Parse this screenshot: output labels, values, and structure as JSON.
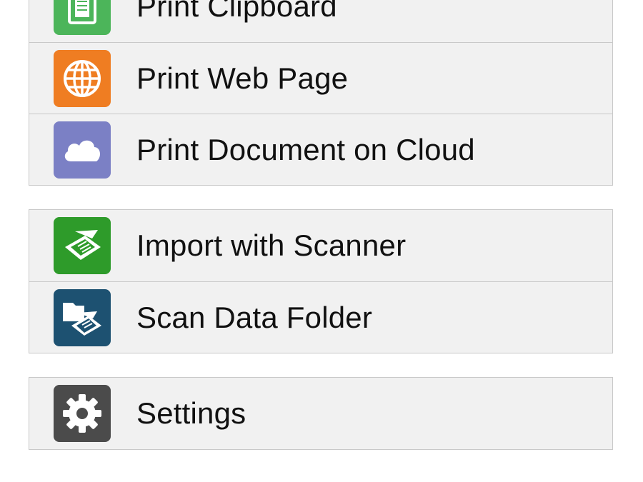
{
  "colors": {
    "clipboard_tile": "#4cb55a",
    "web_tile": "#ef7d22",
    "cloud_tile": "#7b80c5",
    "scanner_tile": "#2e9b2a",
    "folder_tile": "#1d5171",
    "settings_tile": "#4b4b4b",
    "row_background": "#f1f1f1",
    "row_border": "#c9c9c9"
  },
  "menu": {
    "group1": [
      {
        "label": "Print Clipboard",
        "icon": "clipboard-icon"
      },
      {
        "label": "Print Web Page",
        "icon": "globe-icon"
      },
      {
        "label": "Print Document on Cloud",
        "icon": "cloud-icon"
      }
    ],
    "group2": [
      {
        "label": "Import with Scanner",
        "icon": "scanner-icon"
      },
      {
        "label": "Scan Data Folder",
        "icon": "scan-folder-icon"
      }
    ],
    "group3": [
      {
        "label": "Settings",
        "icon": "gear-icon"
      }
    ]
  }
}
